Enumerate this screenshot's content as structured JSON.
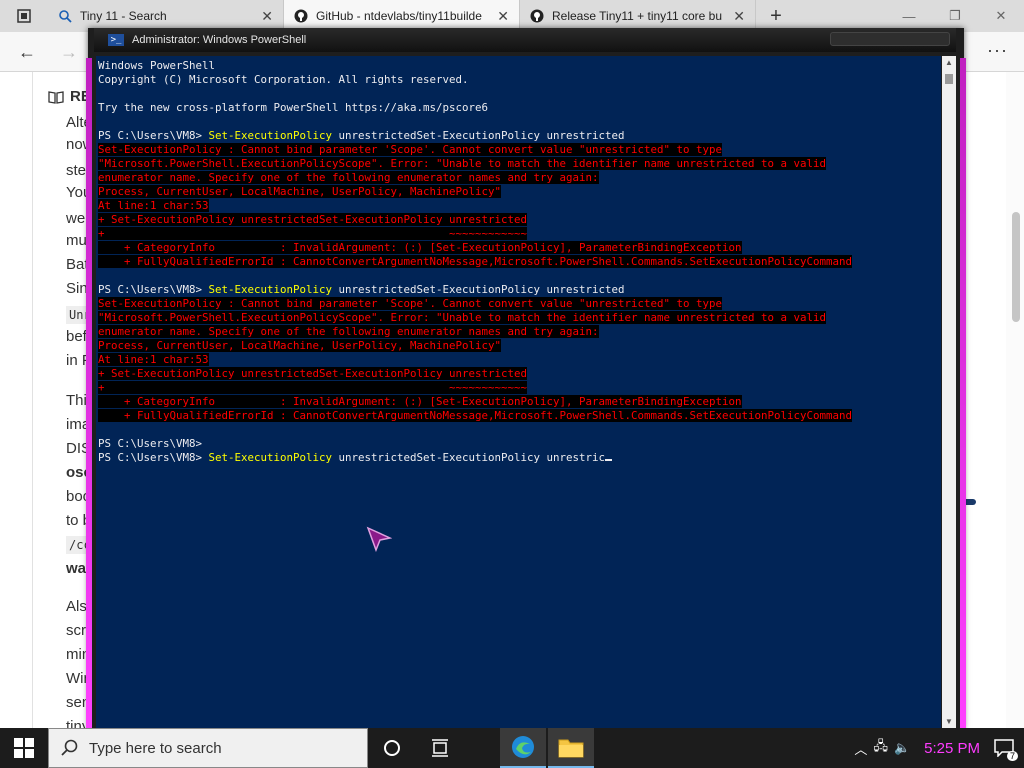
{
  "browser": {
    "tabs": [
      {
        "title": "Tiny 11 - Search",
        "icon": "search-icon",
        "active": false
      },
      {
        "title": "GitHub - ntdevlabs/tiny11builde",
        "icon": "github-icon",
        "active": true
      },
      {
        "title": "Release Tiny11 + tiny11 core bu",
        "icon": "github-icon",
        "active": false
      }
    ],
    "new_tab": "+",
    "back": "←",
    "more": "···",
    "reader_label": "RE"
  },
  "article": {
    "fragments": [
      {
        "text": "Alte",
        "bold": false
      },
      {
        "text": "now",
        "bold": false
      },
      {
        "text": "step",
        "bold": false
      },
      {
        "text": "You",
        "bold": false
      },
      {
        "text": "well",
        "bold": false
      },
      {
        "text": "muc",
        "bold": false
      },
      {
        "text": "Batc",
        "bold": false
      },
      {
        "text": "Sinc",
        "bold": false
      },
      {
        "text": "Unri",
        "bold": false
      },
      {
        "text": "befo",
        "bold": false
      },
      {
        "text": "in Po",
        "bold": false
      },
      {
        "text": "This",
        "bold": false
      },
      {
        "text": "imag",
        "bold": false
      },
      {
        "text": "DISM",
        "bold": false
      },
      {
        "text": "osco",
        "bold": true
      },
      {
        "text": "boot",
        "bold": false
      },
      {
        "text": "to b",
        "bold": false
      },
      {
        "text": "/cc",
        "bold": false
      },
      {
        "text": "warn",
        "bold": true
      },
      {
        "text": "Also",
        "bold": false
      },
      {
        "text": "scrip",
        "bold": false
      },
      {
        "text": "mini",
        "bold": false
      },
      {
        "text": "Win",
        "bold": false
      },
      {
        "text": "sen",
        "bold": false
      },
      {
        "text": "tiny",
        "bold": false
      }
    ]
  },
  "powershell": {
    "title": "Administrator: Windows PowerShell",
    "lines": [
      {
        "type": "out",
        "text": "Windows PowerShell"
      },
      {
        "type": "out",
        "text": "Copyright (C) Microsoft Corporation. All rights reserved."
      },
      {
        "type": "out",
        "text": ""
      },
      {
        "type": "out",
        "text": "Try the new cross-platform PowerShell https://aka.ms/pscore6"
      },
      {
        "type": "out",
        "text": ""
      },
      {
        "type": "prompt",
        "prompt": "PS C:\\Users\\VM8> ",
        "cmd": "Set-ExecutionPolicy",
        "args": " unrestrictedSet-ExecutionPolicy unrestricted"
      },
      {
        "type": "err",
        "text": "Set-ExecutionPolicy : Cannot bind parameter 'Scope'. Cannot convert value \"unrestricted\" to type"
      },
      {
        "type": "err",
        "text": "\"Microsoft.PowerShell.ExecutionPolicyScope\". Error: \"Unable to match the identifier name unrestricted to a valid"
      },
      {
        "type": "err",
        "text": "enumerator name. Specify one of the following enumerator names and try again:"
      },
      {
        "type": "err",
        "text": "Process, CurrentUser, LocalMachine, UserPolicy, MachinePolicy\""
      },
      {
        "type": "err",
        "text": "At line:1 char:53"
      },
      {
        "type": "err",
        "text": "+ Set-ExecutionPolicy unrestrictedSet-ExecutionPolicy unrestricted"
      },
      {
        "type": "err",
        "text": "+                                                     ~~~~~~~~~~~~"
      },
      {
        "type": "err",
        "text": "    + CategoryInfo          : InvalidArgument: (:) [Set-ExecutionPolicy], ParameterBindingException"
      },
      {
        "type": "err",
        "text": "    + FullyQualifiedErrorId : CannotConvertArgumentNoMessage,Microsoft.PowerShell.Commands.SetExecutionPolicyCommand"
      },
      {
        "type": "out",
        "text": ""
      },
      {
        "type": "prompt",
        "prompt": "PS C:\\Users\\VM8> ",
        "cmd": "Set-ExecutionPolicy",
        "args": " unrestrictedSet-ExecutionPolicy unrestricted"
      },
      {
        "type": "err",
        "text": "Set-ExecutionPolicy : Cannot bind parameter 'Scope'. Cannot convert value \"unrestricted\" to type"
      },
      {
        "type": "err",
        "text": "\"Microsoft.PowerShell.ExecutionPolicyScope\". Error: \"Unable to match the identifier name unrestricted to a valid"
      },
      {
        "type": "err",
        "text": "enumerator name. Specify one of the following enumerator names and try again:"
      },
      {
        "type": "err",
        "text": "Process, CurrentUser, LocalMachine, UserPolicy, MachinePolicy\""
      },
      {
        "type": "err",
        "text": "At line:1 char:53"
      },
      {
        "type": "err",
        "text": "+ Set-ExecutionPolicy unrestrictedSet-ExecutionPolicy unrestricted"
      },
      {
        "type": "err",
        "text": "+                                                     ~~~~~~~~~~~~"
      },
      {
        "type": "err",
        "text": "    + CategoryInfo          : InvalidArgument: (:) [Set-ExecutionPolicy], ParameterBindingException"
      },
      {
        "type": "err",
        "text": "    + FullyQualifiedErrorId : CannotConvertArgumentNoMessage,Microsoft.PowerShell.Commands.SetExecutionPolicyCommand"
      },
      {
        "type": "out",
        "text": ""
      },
      {
        "type": "prompt",
        "prompt": "PS C:\\Users\\VM8>",
        "cmd": "",
        "args": ""
      },
      {
        "type": "prompt",
        "prompt": "PS C:\\Users\\VM8> ",
        "cmd": "Set-ExecutionPolicy",
        "args": " unrestrictedSet-ExecutionPolicy unrestric",
        "cursor": true
      }
    ],
    "colors": {
      "background": "#012456",
      "text": "#eeedf0",
      "command": "#ffff00",
      "error": "#ff0000"
    }
  },
  "taskbar": {
    "search_placeholder": "Type here to search",
    "clock": "5:25 PM",
    "notification_count": "7",
    "clock_color": "#ff3cff"
  }
}
